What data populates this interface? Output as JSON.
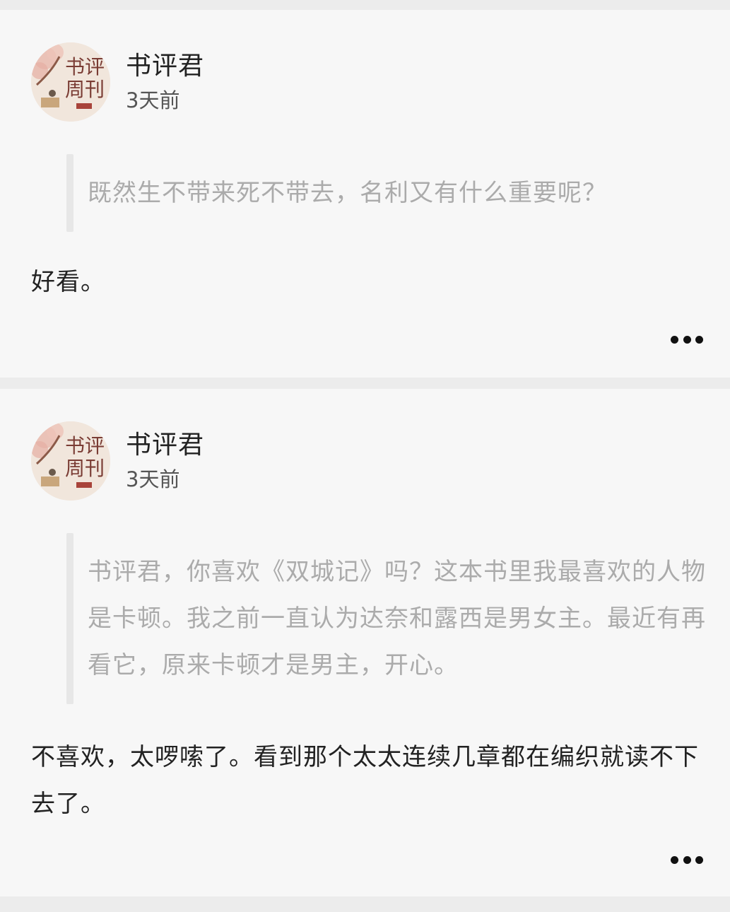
{
  "posts": [
    {
      "author": "书评君",
      "time": "3天前",
      "avatar_text": "书评周刊",
      "quote": "既然生不带来死不带去，名利又有什么重要呢？",
      "reply": "好看。",
      "more_icon": "more-horizontal-icon"
    },
    {
      "author": "书评君",
      "time": "3天前",
      "avatar_text": "书评周刊",
      "quote": "书评君，你喜欢《双城记》吗？这本书里我最喜欢的人物是卡顿。我之前一直认为达奈和露西是男女主。最近有再看它，原来卡顿才是男主，开心。",
      "reply": "不喜欢，太啰嗦了。看到那个太太连续几章都在编织就读不下去了。",
      "more_icon": "more-horizontal-icon"
    }
  ],
  "colors": {
    "page_bg": "#ececec",
    "card_bg": "#f7f7f7",
    "quote_text": "#ababab",
    "quote_bar": "#e7e7e7",
    "body_text": "#222222"
  }
}
